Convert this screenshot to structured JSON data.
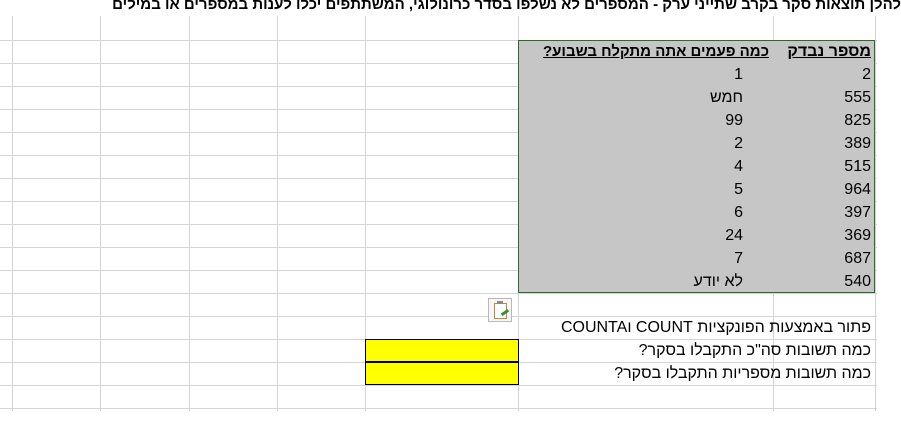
{
  "sheet": {
    "title": "להלן תוצאות סקר בקרב שתייני ערק  - המספרים לא נשלפו בסדר כרונולוגי, המשתתפים יכלו לענות במספרים או במילים",
    "table": {
      "headers": {
        "id": "מספר נבדק",
        "answer": "כמה פעמים אתה מתקלח בשבוע?"
      },
      "rows": [
        {
          "id": "2",
          "answer": "1"
        },
        {
          "id": "555",
          "answer": "חמש"
        },
        {
          "id": "825",
          "answer": "99"
        },
        {
          "id": "389",
          "answer": "2"
        },
        {
          "id": "515",
          "answer": "4"
        },
        {
          "id": "964",
          "answer": "5"
        },
        {
          "id": "397",
          "answer": "6"
        },
        {
          "id": "369",
          "answer": "24"
        },
        {
          "id": "687",
          "answer": "7"
        },
        {
          "id": "540",
          "answer": "לא יודע"
        }
      ]
    },
    "instructions": "פתור באמצעות הפונקציות COUNT וCOUNTA",
    "questions": [
      "כמה תשובות סה\"כ התקבלו בסקר?",
      "כמה תשובות מספריות התקבלו בסקר?"
    ],
    "answer_cells": [
      "",
      ""
    ],
    "colors": {
      "selection_fill": "#c6c6c6",
      "selection_border": "#2d6a2d",
      "answer_fill": "#ffff00",
      "gridline": "#d4d4d4"
    },
    "icons": {
      "paste_options": "paste-options-icon"
    }
  }
}
